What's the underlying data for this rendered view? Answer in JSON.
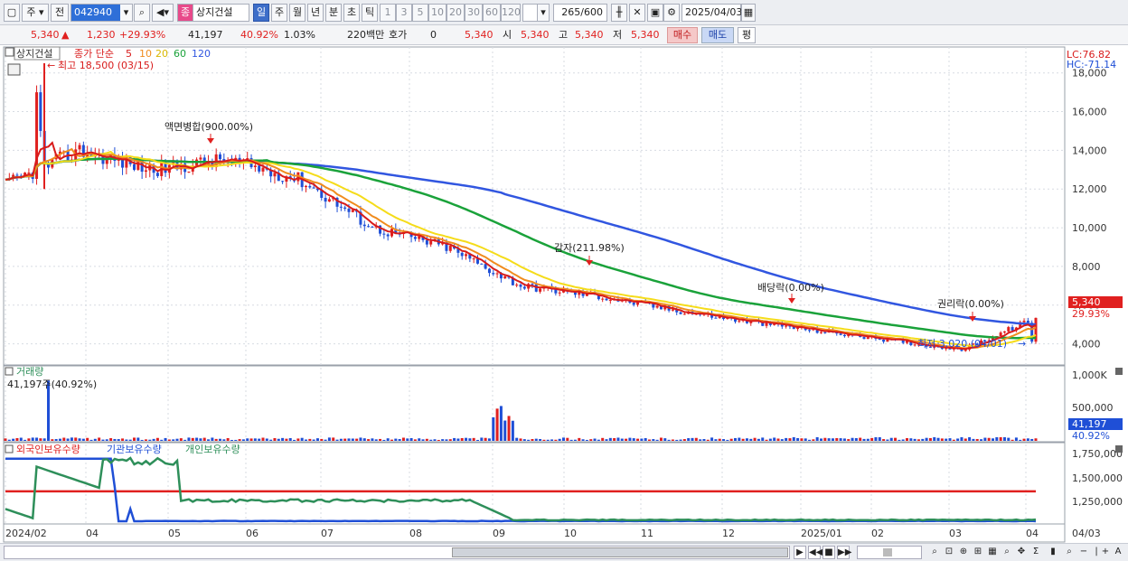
{
  "toolbar": {
    "market": "주",
    "type": "전",
    "code": "042940",
    "name_badge": "종",
    "name": "상지건설",
    "periods": [
      "일",
      "주",
      "월",
      "년",
      "분",
      "초",
      "틱"
    ],
    "intervals": [
      "1",
      "3",
      "5",
      "10",
      "20",
      "30",
      "60",
      "120"
    ],
    "count": "265",
    "count_max": "/600",
    "date": "2025/04/03"
  },
  "quote": {
    "price": "5,340",
    "change": "1,230",
    "change_pct": "+29.93%",
    "volume": "41,197",
    "vol_pct": "40.92%",
    "turnover_pct": "1.03%",
    "amount": "220백만",
    "hoga_label": "호가",
    "hoga_value": "0",
    "hoga_price": "5,340",
    "open_label": "시",
    "open": "5,340",
    "high_label": "고",
    "high": "5,340",
    "low_label": "저",
    "low": "5,340",
    "buy": "매수",
    "sell": "매도",
    "avg": "평"
  },
  "price_panel": {
    "stock_name": "상지건설",
    "ma_label": "종가 단순",
    "ma_periods": [
      "5",
      "10",
      "20",
      "60",
      "120"
    ],
    "ma_colors": [
      "#d81b1b",
      "#f08c1e",
      "#f5dc1a",
      "#1aa23a",
      "#3156e0"
    ],
    "lc": "LC:76.82",
    "hc": "HC:-71.14",
    "high_marker": "최고 18,500 (03/15)",
    "low_marker": "최저 3,020 (04/01)",
    "events": [
      "액면병합(900.00%)",
      "감자(211.98%)",
      "배당락(0.00%)",
      "권리락(0.00%)"
    ],
    "y_ticks": [
      "18,000",
      "16,000",
      "14,000",
      "12,000",
      "10,000",
      "8,000",
      "6,000",
      "4,000"
    ],
    "last_price_tag": "5,340",
    "last_change_tag": "29.93%"
  },
  "volume_panel": {
    "title": "거래량",
    "current": "41,197주(40.92%)",
    "y_ticks": [
      "1,000K",
      "500,000"
    ],
    "tag_value": "41,197",
    "tag_pct": "40.92%"
  },
  "holder_panel": {
    "series": [
      {
        "name": "외국인보유수량",
        "color": "#e0201f"
      },
      {
        "name": "기관보유수량",
        "color": "#1f4fd6"
      },
      {
        "name": "개인보유수량",
        "color": "#2e8f5a"
      }
    ],
    "y_ticks": [
      "1,750,000",
      "1,500,000",
      "1,250,000"
    ]
  },
  "x_axis": {
    "labels": [
      "2024/02",
      "04",
      "05",
      "06",
      "07",
      "08",
      "09",
      "10",
      "11",
      "12",
      "2025/01",
      "02",
      "03",
      "04"
    ],
    "right_label": "04/03"
  },
  "chart_data": {
    "type": "line",
    "x": [
      "2024/02",
      "2024/03",
      "2024/04",
      "2024/05",
      "2024/06",
      "2024/07",
      "2024/08",
      "2024/09",
      "2024/10",
      "2024/11",
      "2024/12",
      "2025/01",
      "2025/02",
      "2025/03",
      "2025/04"
    ],
    "series": [
      {
        "name": "종가",
        "values": [
          12200,
          14000,
          13000,
          13500,
          12500,
          10000,
          9000,
          7000,
          6500,
          5800,
          5200,
          4700,
          4200,
          3700,
          5340
        ]
      },
      {
        "name": "120",
        "values": [
          14000,
          13300,
          13100,
          13000,
          12900,
          12600,
          12000,
          11000,
          9800,
          8700,
          7700,
          6800,
          5900,
          5300,
          4900
        ]
      }
    ],
    "volume": [
      30000,
      1000000,
      40000,
      20000,
      30000,
      40000,
      560000,
      40000,
      20000,
      60000,
      30000,
      30000,
      30000,
      40000,
      41197
    ],
    "ylim": [
      3000,
      18500
    ]
  },
  "bottom": {
    "zoom_minus": "−",
    "zoom_plus": "+",
    "auto": "A"
  }
}
